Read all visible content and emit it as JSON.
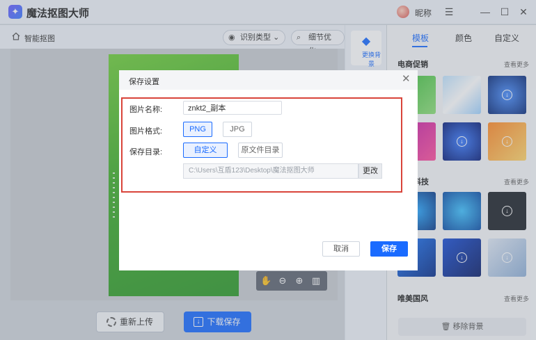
{
  "app": {
    "title": "魔法抠图大师",
    "logo_glyph": "✦",
    "nickname": "昵称",
    "accent": "#1a6bff"
  },
  "window_controls": {
    "menu": "☰",
    "minimize": "—",
    "maximize": "☐",
    "close": "✕"
  },
  "toolbar": {
    "breadcrumb": "智能抠图",
    "recognize_type": "识别类型",
    "detail_optimize": "细节优化"
  },
  "bottom": {
    "reupload": "重新上传",
    "download_save": "下载保存"
  },
  "strip": {
    "change_bg": "更换背景"
  },
  "panel": {
    "tabs": [
      "模板",
      "颜色",
      "自定义"
    ],
    "active_tab": 0,
    "sections": [
      {
        "title": "电商促销",
        "more": "查看更多"
      },
      {
        "title": "科技",
        "more": "查看更多"
      },
      {
        "title": "唯美国风",
        "more": "查看更多"
      }
    ],
    "remove_bg": "移除背景"
  },
  "dialog": {
    "title": "保存设置",
    "name_label": "图片名称:",
    "name_value": "znkt2_副本",
    "format_label": "图片格式:",
    "format_options": [
      "PNG",
      "JPG"
    ],
    "format_selected": "PNG",
    "dir_label": "保存目录:",
    "dir_options": [
      "自定义",
      "原文件目录"
    ],
    "dir_selected": "自定义",
    "path": "C:\\Users\\互盾123\\Desktop\\魔法抠图大师",
    "change": "更改",
    "cancel": "取消",
    "save": "保存"
  }
}
